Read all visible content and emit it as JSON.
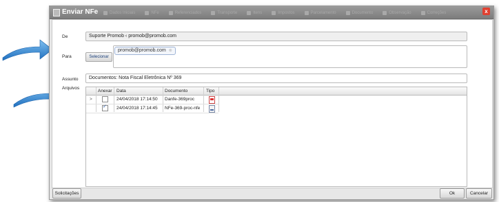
{
  "window": {
    "title": "Enviar NFe",
    "tabs": [
      "Dados Iniciais",
      "NFe",
      "Referenciados",
      "Transporte",
      "Itens",
      "Impostos",
      "Parcelamento",
      "Documento",
      "Observação",
      "Correções"
    ],
    "close_label": "x"
  },
  "form": {
    "de_label": "De",
    "de_value": "Suporte Promob ‹ promob@promob.com",
    "para_label": "Para",
    "selecionar_label": "Selecionar",
    "para_chip": "promob@promob.com",
    "assunto_label": "Assunto",
    "assunto_value": "Documentos: Nota Fiscal Eletrônica Nº 369",
    "arquivos_label": "Arquivos"
  },
  "grid": {
    "headers": [
      "Anexar",
      "Data",
      "Documento",
      "Tipo"
    ],
    "rows": [
      {
        "marker": ">",
        "anexar": false,
        "data": "24/04/2018 17:14:50",
        "documento": "Danfe-369proc",
        "tipo": "pdf"
      },
      {
        "marker": "",
        "anexar": true,
        "data": "24/04/2018 17:14:45",
        "documento": "NFe-369-proc-nfe",
        "tipo": "xml"
      }
    ]
  },
  "footer": {
    "solicitacoes_label": "Solicitações",
    "ok_label": "Ok",
    "cancelar_label": "Cancelar"
  },
  "colors": {
    "arrow": "#2f7fd0",
    "close": "#e04030"
  },
  "icons": [
    "arrow-right-icon",
    "close-icon",
    "pdf-file-icon",
    "xml-file-icon"
  ]
}
